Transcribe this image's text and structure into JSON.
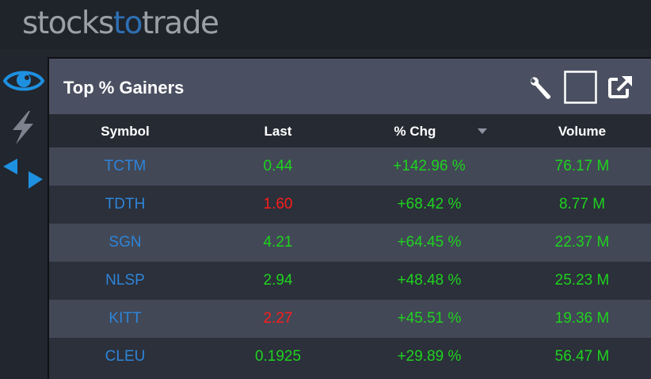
{
  "app": {
    "logo_left": "stocks",
    "logo_accent": "to",
    "logo_right": "trade"
  },
  "sidebar": {
    "icons": [
      "eye-icon",
      "lightning-icon",
      "arrows-icon"
    ],
    "accent_color": "#1e90e0"
  },
  "panel": {
    "title": "Top % Gainers",
    "buttons": [
      "wrench-icon",
      "maximize-icon",
      "popout-icon"
    ]
  },
  "table": {
    "columns": [
      "Symbol",
      "Last",
      "% Chg",
      "Volume"
    ],
    "sort_column": "% Chg",
    "sort_direction": "descending",
    "rows": [
      {
        "symbol": "TCTM",
        "last": "0.44",
        "last_dir": "up",
        "chg": "+142.96 %",
        "volume": "76.17 M"
      },
      {
        "symbol": "TDTH",
        "last": "1.60",
        "last_dir": "down",
        "chg": "+68.42 %",
        "volume": "8.77 M"
      },
      {
        "symbol": "SGN",
        "last": "4.21",
        "last_dir": "up",
        "chg": "+64.45 %",
        "volume": "22.37 M"
      },
      {
        "symbol": "NLSP",
        "last": "2.94",
        "last_dir": "up",
        "chg": "+48.48 %",
        "volume": "25.23 M"
      },
      {
        "symbol": "KITT",
        "last": "2.27",
        "last_dir": "down",
        "chg": "+45.51 %",
        "volume": "19.36 M"
      },
      {
        "symbol": "CLEU",
        "last": "0.1925",
        "last_dir": "up",
        "chg": "+29.89 %",
        "volume": "56.47 M"
      }
    ]
  },
  "colors": {
    "symbol": "#2f84d8",
    "up": "#1fd21f",
    "down": "#ff1c1c"
  }
}
